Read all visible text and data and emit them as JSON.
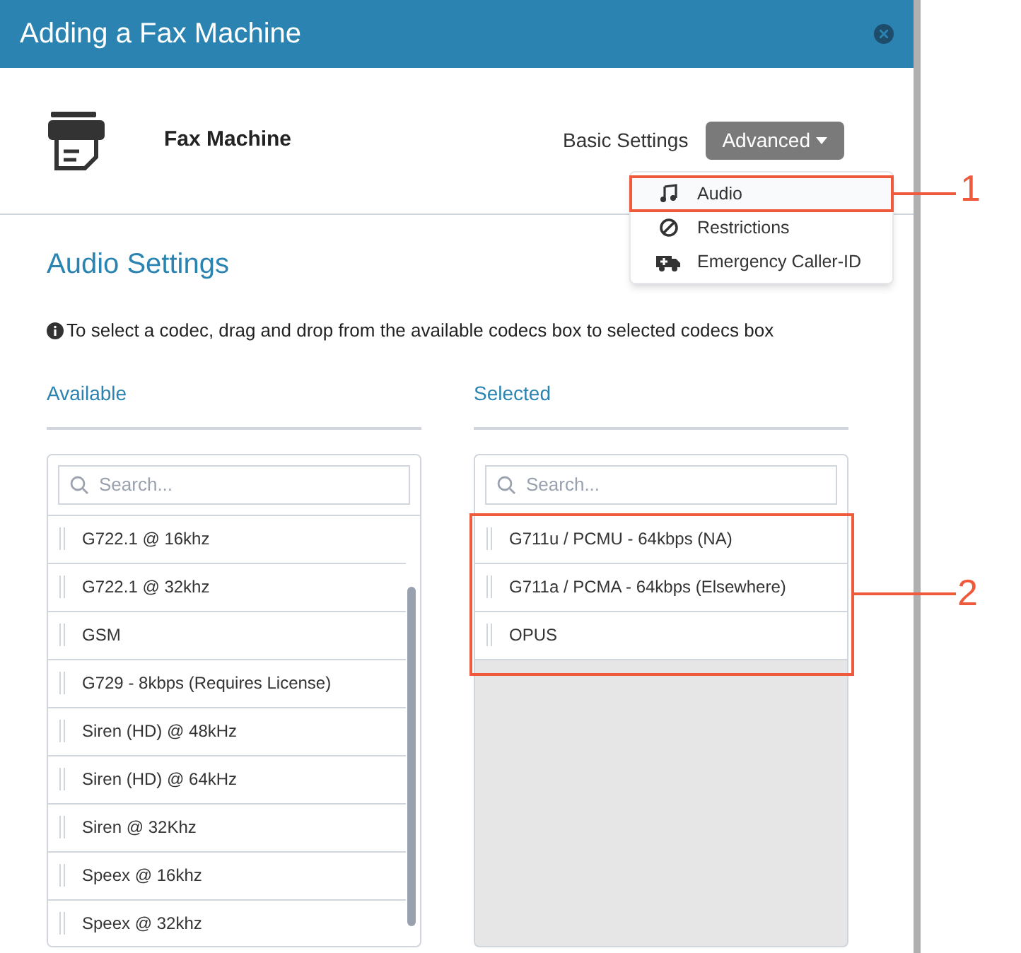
{
  "window": {
    "title": "Adding a Fax Machine"
  },
  "device": {
    "name": "Fax Machine"
  },
  "nav": [
    {
      "label": "Basic Settings",
      "kind": "link"
    },
    {
      "label": "Advanced",
      "kind": "dropdown",
      "expanded": true
    }
  ],
  "menu": [
    {
      "label": "Audio",
      "selected": true
    },
    {
      "label": "Restrictions",
      "selected": false
    },
    {
      "label": "Emergency Caller-ID",
      "selected": false
    }
  ],
  "section_title": "Audio Settings",
  "hint": "To select a codec, drag and drop from the available codecs box to selected codecs box",
  "available": {
    "heading": "Available",
    "placeholder": "Search...",
    "items": [
      "G722.1 @ 16khz",
      "G722.1 @ 32khz",
      "GSM",
      "G729 - 8kbps (Requires License)",
      "Siren (HD) @ 48kHz",
      "Siren (HD) @ 64kHz",
      "Siren @ 32Khz",
      "Speex @ 16khz",
      "Speex @ 32khz"
    ]
  },
  "selected": {
    "heading": "Selected",
    "placeholder": "Search...",
    "items": [
      "G711u / PCMU - 64kbps (NA)",
      "G711a / PCMA - 64kbps (Elsewhere)",
      "OPUS"
    ]
  },
  "callouts": [
    "1",
    "2"
  ]
}
